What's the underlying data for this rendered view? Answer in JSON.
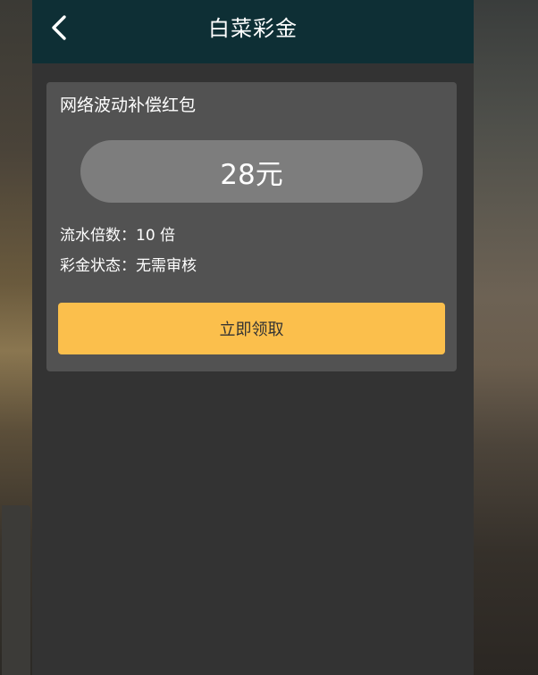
{
  "header": {
    "title": "白菜彩金",
    "back_icon": "chevron-left-icon"
  },
  "bonus": {
    "name": "网络波动补偿红包",
    "amount": "28元",
    "turnover_label": "流水倍数：",
    "turnover_value": "10 倍",
    "status_label": "彩金状态：",
    "status_value": "无需审核",
    "claim_label": "立即领取"
  },
  "colors": {
    "header_bg": "#0e2f35",
    "page_bg": "#333333",
    "card_bg": "#525252",
    "pill_bg": "#7d7d7d",
    "button_bg": "#fbbf4c"
  }
}
